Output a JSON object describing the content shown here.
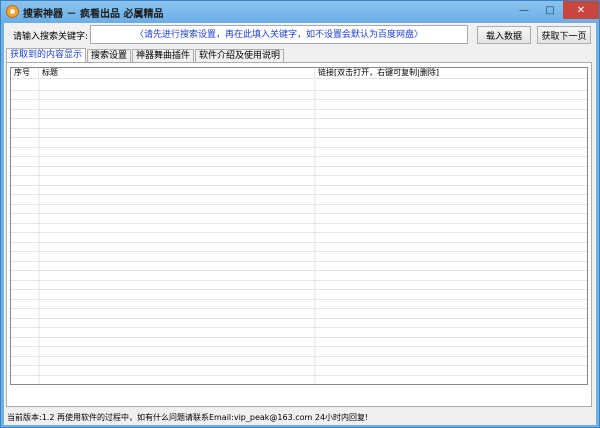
{
  "window": {
    "title": "搜索神器 － 疯看出品 必属精品",
    "minimize_glyph": "—",
    "maximize_glyph": "□",
    "close_glyph": "✕"
  },
  "toolbar": {
    "keyword_label": "请输入搜索关键字:",
    "keyword_placeholder": "〈请先进行搜索设置，再在此填入关键字，如不设置会默认为百度网盘〉",
    "keyword_value": "",
    "load_button": "载入数据",
    "next_page_button": "获取下一页"
  },
  "tabs": [
    {
      "label": "获取到的内容显示",
      "active": true
    },
    {
      "label": "搜索设置",
      "active": false
    },
    {
      "label": "神器舞曲插件",
      "active": false
    },
    {
      "label": "软件介绍及使用说明",
      "active": false
    }
  ],
  "list": {
    "columns": {
      "no": "序号",
      "title": "标题",
      "link": "链接[双击打开，右键可复制|删除]"
    },
    "rows": []
  },
  "status": {
    "text": "当前版本:1.2  再使用软件的过程中，如有什么问题请联系Email:vip_peak@163.com 24小时内回复!"
  },
  "colors": {
    "title_bar": "#6fb0e6",
    "close_button": "#c7473e",
    "placeholder_text": "#1f3fd0",
    "active_tab_text": "#1f3fd0",
    "grid_line": "#e5e5e5"
  }
}
